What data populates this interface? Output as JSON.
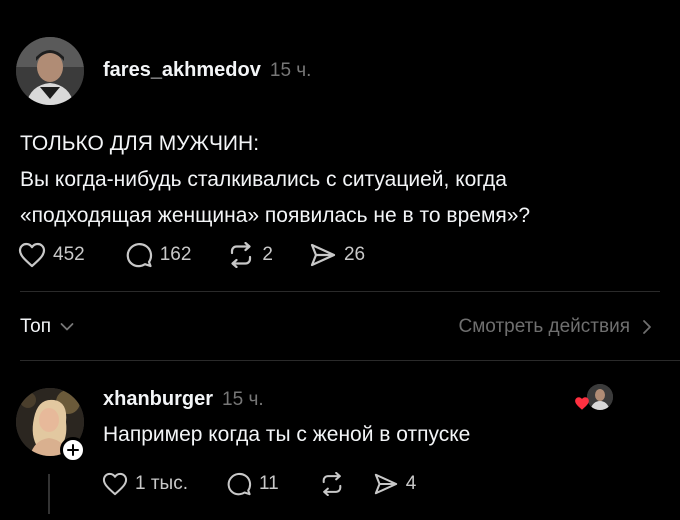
{
  "post": {
    "username": "fares_akhmedov",
    "time": "15 ч.",
    "text_line1": "ТОЛЬКО ДЛЯ МУЖЧИН:",
    "text_line2": "Вы когда-нибудь сталкивались с ситуацией, когда",
    "text_line3": "«подходящая женщина» появилась не в то время»?",
    "likes": "452",
    "comments": "162",
    "reposts": "2",
    "shares": "26"
  },
  "sort": {
    "label": "Топ",
    "activity_label": "Смотреть действия"
  },
  "reply": {
    "username": "xhanburger",
    "time": "15 ч.",
    "text": "Например когда ты с женой в отпуске",
    "likes": "1 тыс.",
    "comments": "11",
    "shares": "4"
  },
  "colors": {
    "background": "#000000",
    "text": "#f3f5f7",
    "muted": "#777777",
    "like_heart": "#ff3040"
  },
  "icons": [
    "heart-icon",
    "comment-icon",
    "repost-icon",
    "share-icon",
    "chevron-down-icon",
    "chevron-right-icon",
    "plus-icon"
  ]
}
